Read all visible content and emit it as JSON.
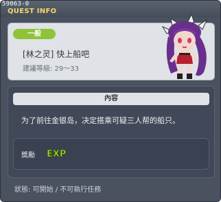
{
  "window": {
    "quest_id": "59063-0",
    "title": "QUEST INFO"
  },
  "quest": {
    "difficulty": "一般",
    "name": "[林之灵] 快上船吧",
    "level_text": "建議等級: 29～33"
  },
  "content": {
    "header": "內容",
    "description": "为了前往金银岛，决定搭乘可疑三人帮的船只。"
  },
  "reward": {
    "label": "獎勵",
    "type_text": "EXP"
  },
  "status": {
    "text": "狀態:  可開始 / 不可執行任務"
  },
  "colors": {
    "window_bg": "#4a5260",
    "title": "#f2d86a",
    "badge": "#8fc33a",
    "exp": "#a6e22e"
  },
  "icons": {
    "npc": "npc-portrait",
    "exp": "exp-icon"
  }
}
